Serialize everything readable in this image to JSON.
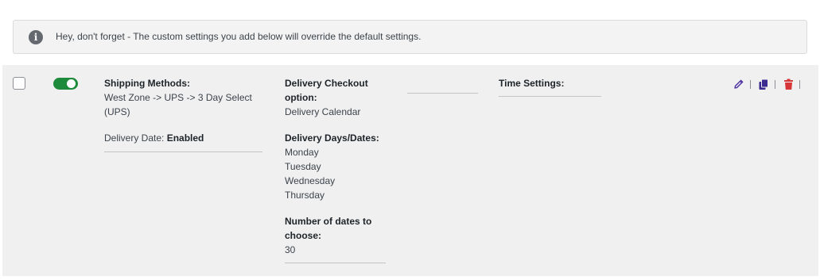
{
  "notice": {
    "icon": "info-icon",
    "icon_glyph": "i",
    "text": "Hey, don't forget - The custom settings you add below will override the default settings."
  },
  "rule": {
    "checked": false,
    "enabled": true,
    "toggle_color": "#1e8a3c",
    "shipping": {
      "label": "Shipping Methods:",
      "value": "West Zone -> UPS -> 3 Day Select (UPS)",
      "delivery_date_label": "Delivery Date:",
      "delivery_date_value": "Enabled"
    },
    "checkout": {
      "label": "Delivery Checkout option:",
      "value": "Delivery Calendar",
      "days_label": "Delivery Days/Dates:",
      "days": [
        "Monday",
        "Tuesday",
        "Wednesday",
        "Thursday"
      ],
      "dates_count_label": "Number of dates to choose:",
      "dates_count_value": "30"
    },
    "time_settings": {
      "label": "Time Settings:"
    },
    "actions": {
      "edit_icon": "pencil-icon",
      "copy_icon": "copy-icon",
      "delete_icon": "trash-icon",
      "edit_color": "#4b2fa0",
      "copy_color": "#3b2a8f",
      "delete_color": "#d63638"
    }
  }
}
